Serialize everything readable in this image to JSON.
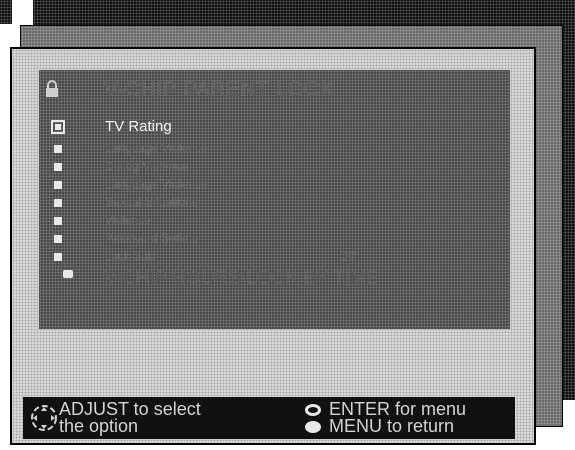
{
  "menu": {
    "title": "V-CHIP PARENT LOCK",
    "items": [
      {
        "label": "TV Rating",
        "value": "",
        "selected": true
      },
      {
        "label": "Language Violence",
        "value": ""
      },
      {
        "label": "Dialog Violence",
        "value": ""
      },
      {
        "label": "Language Violence",
        "value": ""
      },
      {
        "label": "Sexual Situations",
        "value": ""
      },
      {
        "label": "Violence",
        "value": ""
      },
      {
        "label": "Password Setting",
        "value": ""
      },
      {
        "label": "Lock Sub",
        "value": "Off"
      }
    ],
    "hours_label": "V-CHIP HOURS/LOCK BY TIME"
  },
  "footer": {
    "adjust_line1": "ADJUST  to select",
    "adjust_line2": "the option",
    "enter_line": "ENTER for menu",
    "menu_line": "MENU to return"
  }
}
